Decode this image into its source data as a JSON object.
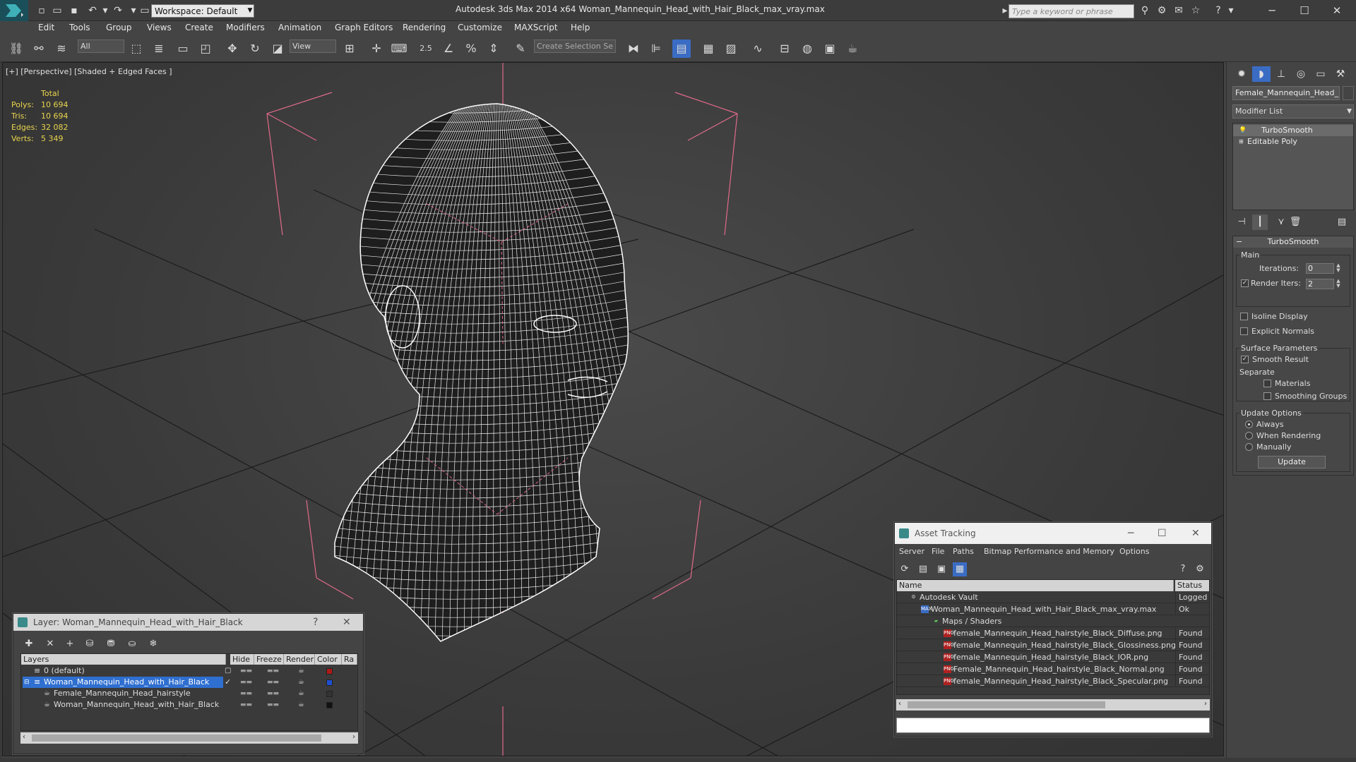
{
  "titlebar": {
    "app_title": "Autodesk 3ds Max  2014 x64      Woman_Mannequin_Head_with_Hair_Black_max_vray.max",
    "workspace": "Workspace: Default",
    "search_placeholder": "Type a keyword or phrase"
  },
  "menu": [
    "Edit",
    "Tools",
    "Group",
    "Views",
    "Create",
    "Modifiers",
    "Animation",
    "Graph Editors",
    "Rendering",
    "Customize",
    "MAXScript",
    "Help"
  ],
  "toolbar": {
    "filter": "All",
    "ref_coord": "View",
    "snap_angle_label": "2.5",
    "selection_set_placeholder": "Create Selection Se"
  },
  "viewport": {
    "label": "[+] [Perspective] [Shaded + Edged Faces ]",
    "stats": {
      "header": "Total",
      "rows": [
        {
          "label": "Polys:",
          "value": "10 694"
        },
        {
          "label": "Tris:",
          "value": "10 694"
        },
        {
          "label": "Edges:",
          "value": "32 082"
        },
        {
          "label": "Verts:",
          "value": "5 349"
        }
      ]
    }
  },
  "command_panel": {
    "object_name": "Female_Mannequin_Head_ha",
    "modifier_list": "Modifier List",
    "stack": [
      "TurboSmooth",
      "Editable Poly"
    ],
    "turbosmooth": {
      "title": "TurboSmooth",
      "main_label": "Main",
      "iterations_label": "Iterations:",
      "iterations_value": "0",
      "render_iters_label": "Render Iters:",
      "render_iters_value": "2",
      "isoline": "Isoline Display",
      "explicit": "Explicit Normals",
      "surface_params": "Surface Parameters",
      "smooth_result": "Smooth Result",
      "separate": "Separate",
      "materials": "Materials",
      "smoothing_groups": "Smoothing Groups",
      "update_options": "Update Options",
      "always": "Always",
      "when_rendering": "When Rendering",
      "manually": "Manually",
      "update_button": "Update"
    }
  },
  "layer_dialog": {
    "title": "Layer: Woman_Mannequin_Head_with_Hair_Black",
    "help": "?",
    "columns": [
      "Layers",
      "Hide",
      "Freeze",
      "Render",
      "Color",
      "Ra"
    ],
    "rows": [
      {
        "name": "0 (default)",
        "color": "#b01818"
      },
      {
        "name": "Woman_Mannequin_Head_with_Hair_Black",
        "color": "#1f4fd0"
      },
      {
        "name": "Female_Mannequin_Head_hairstyle",
        "color": "#333333"
      },
      {
        "name": "Woman_Mannequin_Head_with_Hair_Black",
        "color": "#111111"
      }
    ]
  },
  "asset_tracking": {
    "title": "Asset Tracking",
    "menu": [
      "Server",
      "File",
      "Paths",
      "Bitmap Performance and Memory",
      "Options"
    ],
    "columns": [
      "Name",
      "Status"
    ],
    "rows": [
      {
        "name": "Autodesk Vault",
        "status": "Logged O"
      },
      {
        "name": "Woman_Mannequin_Head_with_Hair_Black_max_vray.max",
        "status": "Ok"
      },
      {
        "name": "Maps / Shaders",
        "status": ""
      },
      {
        "name": "female_Mannequin_Head_hairstyle_Black_Diffuse.png",
        "status": "Found"
      },
      {
        "name": "female_Mannequin_Head_hairstyle_Black_Glossiness.png",
        "status": "Found"
      },
      {
        "name": "female_Mannequin_Head_hairstyle_Black_IOR.png",
        "status": "Found"
      },
      {
        "name": "Female_Mannequin_Head_hairstyle_Black_Normal.png",
        "status": "Found"
      },
      {
        "name": "female_Mannequin_Head_hairstyle_Black_Specular.png",
        "status": "Found"
      }
    ]
  },
  "colors": {
    "accent": "#2f6fd0",
    "stats": "#e8d44d",
    "bounding_box": "#e06a8a"
  }
}
